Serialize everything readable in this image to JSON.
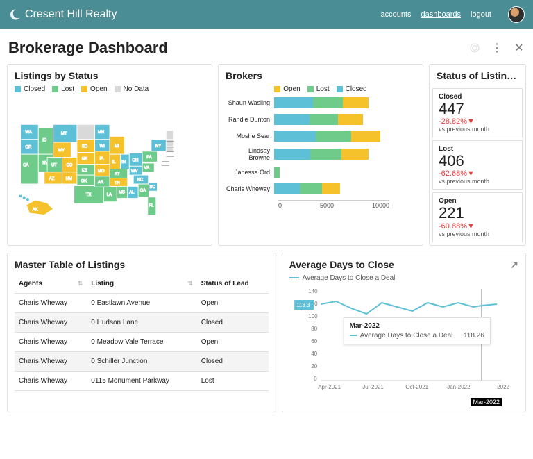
{
  "brand": "Cresent Hill Realty",
  "nav": {
    "accounts": "accounts",
    "dashboards": "dashboards",
    "logout": "logout"
  },
  "page": {
    "title": "Brokerage Dashboard"
  },
  "colors": {
    "closed": "#5ec0d6",
    "lost": "#6ecb8a",
    "open": "#f5c22b",
    "nodata": "#d9d9d9"
  },
  "listingsByStatus": {
    "title": "Listings by Status",
    "legend": [
      "Closed",
      "Lost",
      "Open",
      "No Data"
    ]
  },
  "brokers": {
    "title": "Brokers",
    "legend": [
      "Open",
      "Lost",
      "Closed"
    ],
    "series": [
      {
        "name": "Shaun Wasling",
        "closed": 4200,
        "lost": 3200,
        "open": 2800
      },
      {
        "name": "Randie Dunton",
        "closed": 3800,
        "lost": 3100,
        "open": 2700
      },
      {
        "name": "Moshe Sear",
        "closed": 4500,
        "lost": 3800,
        "open": 3200
      },
      {
        "name": "Lindsay Browne",
        "closed": 3900,
        "lost": 3400,
        "open": 2900
      },
      {
        "name": "Janessa Ord",
        "closed": 0,
        "lost": 600,
        "open": 0
      },
      {
        "name": "Charis Wheway",
        "closed": 2800,
        "lost": 2400,
        "open": 1900
      }
    ],
    "ticks": [
      "0",
      "5000",
      "10000"
    ]
  },
  "statusOfListings": {
    "title": "Status of Listin…",
    "items": [
      {
        "label": "Closed",
        "value": "447",
        "pct": "-28.82%",
        "arrow": "▼",
        "sub": "vs previous month"
      },
      {
        "label": "Lost",
        "value": "406",
        "pct": "-62.68%",
        "arrow": "▼",
        "sub": "vs previous month"
      },
      {
        "label": "Open",
        "value": "221",
        "pct": "-60.88%",
        "arrow": "▼",
        "sub": "vs previous month"
      }
    ]
  },
  "masterTable": {
    "title": "Master Table of Listings",
    "columns": [
      "Agents",
      "Listing",
      "Status of Lead"
    ],
    "rows": [
      {
        "agent": "Charis Wheway",
        "listing": "0 Eastlawn Avenue",
        "status": "Open"
      },
      {
        "agent": "Charis Wheway",
        "listing": "0 Hudson Lane",
        "status": "Closed"
      },
      {
        "agent": "Charis Wheway",
        "listing": "0 Meadow Vale Terrace",
        "status": "Open"
      },
      {
        "agent": "Charis Wheway",
        "listing": "0 Schiller Junction",
        "status": "Closed"
      },
      {
        "agent": "Charis Wheway",
        "listing": "0115 Monument Parkway",
        "status": "Lost"
      }
    ]
  },
  "avgDays": {
    "title": "Average Days to Close",
    "seriesLabel": "Average Days to Close a Deal",
    "yTicks": [
      "140",
      "120",
      "100",
      "80",
      "60",
      "40",
      "20",
      "0"
    ],
    "xTicks": [
      "Apr-2021",
      "Jul-2021",
      "Oct-2021",
      "Jan-2022",
      "Mar-2022",
      "2022"
    ],
    "badge": "118.3",
    "tooltip": {
      "month": "Mar-2022",
      "label": "Average Days to Close a Deal",
      "value": "118.26"
    }
  },
  "chart_data": [
    {
      "type": "map",
      "title": "Listings by Status",
      "categories_legend": [
        "Closed",
        "Lost",
        "Open",
        "No Data"
      ]
    },
    {
      "type": "bar",
      "title": "Brokers",
      "orientation": "horizontal",
      "stacked": true,
      "categories": [
        "Shaun Wasling",
        "Randie Dunton",
        "Moshe Sear",
        "Lindsay Browne",
        "Janessa Ord",
        "Charis Wheway"
      ],
      "series": [
        {
          "name": "Closed",
          "values": [
            4200,
            3800,
            4500,
            3900,
            0,
            2800
          ]
        },
        {
          "name": "Lost",
          "values": [
            3200,
            3100,
            3800,
            3400,
            600,
            2400
          ]
        },
        {
          "name": "Open",
          "values": [
            2800,
            2700,
            3200,
            2900,
            0,
            1900
          ]
        }
      ],
      "xlim": [
        0,
        12000
      ],
      "xticks": [
        0,
        5000,
        10000
      ]
    },
    {
      "type": "line",
      "title": "Average Days to Close",
      "x": [
        "Apr-2021",
        "May-2021",
        "Jun-2021",
        "Jul-2021",
        "Aug-2021",
        "Sep-2021",
        "Oct-2021",
        "Nov-2021",
        "Dec-2021",
        "Jan-2022",
        "Feb-2022",
        "Mar-2022",
        "Apr-2022"
      ],
      "series": [
        {
          "name": "Average Days to Close a Deal",
          "values": [
            118,
            122,
            112,
            105,
            120,
            116,
            110,
            120,
            115,
            120,
            116,
            118,
            119
          ]
        }
      ],
      "ylim": [
        0,
        140
      ],
      "highlight": {
        "x": "Mar-2022",
        "value": 118.26
      }
    }
  ]
}
